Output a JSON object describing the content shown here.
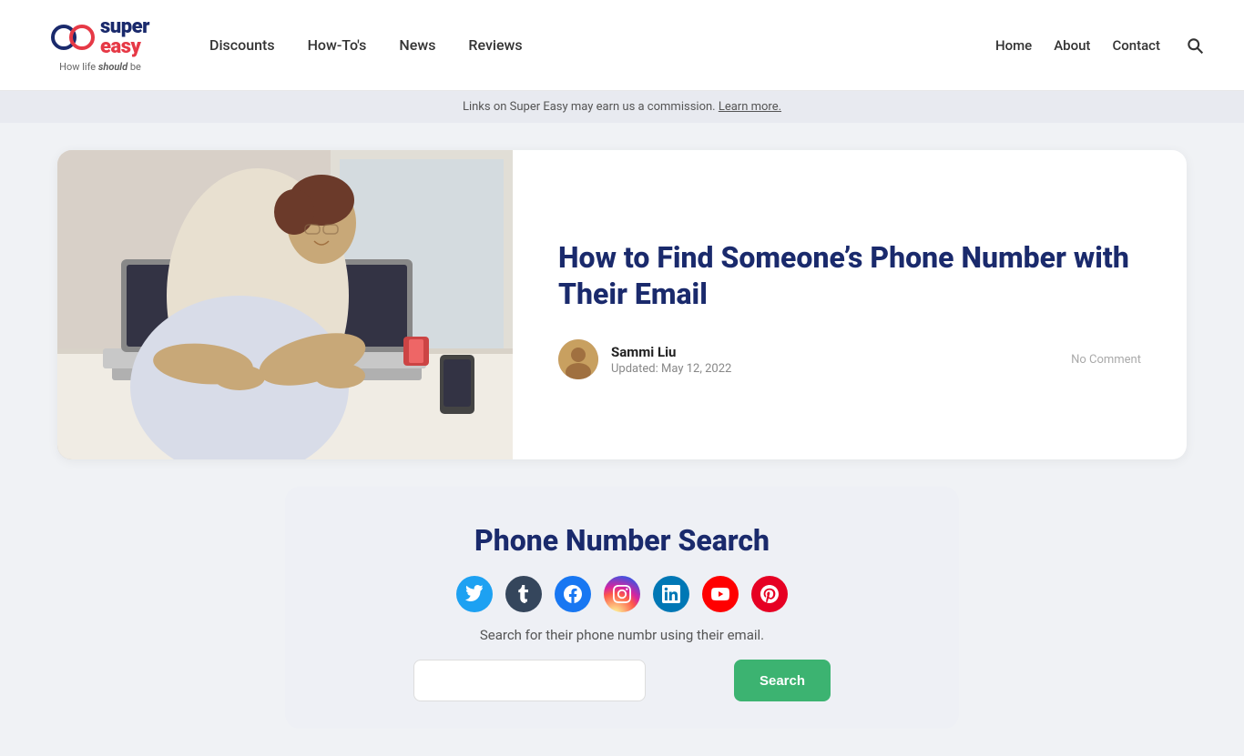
{
  "header": {
    "logo": {
      "brand_super": "super",
      "brand_easy": "easy",
      "tagline": "How life ",
      "tagline_emphasis": "should",
      "tagline_rest": " be"
    },
    "nav": {
      "items": [
        {
          "label": "Discounts",
          "href": "#"
        },
        {
          "label": "How-To's",
          "href": "#"
        },
        {
          "label": "News",
          "href": "#"
        },
        {
          "label": "Reviews",
          "href": "#"
        }
      ]
    },
    "right_nav": {
      "items": [
        {
          "label": "Home",
          "href": "#"
        },
        {
          "label": "About",
          "href": "#"
        },
        {
          "label": "Contact",
          "href": "#"
        }
      ]
    }
  },
  "affiliate_bar": {
    "text": "Links on Super Easy may earn us a commission. ",
    "link_text": "Learn more."
  },
  "article": {
    "title": "How to Find Someone’s Phone Number with Their Email",
    "author_name": "Sammi Liu",
    "updated_label": "Updated:",
    "updated_date": "May 12, 2022",
    "no_comment": "No Comment"
  },
  "widget": {
    "title": "Phone Number Search",
    "description": "Search for their phone numbr using their email.",
    "search_placeholder": "",
    "button_label": "Search"
  },
  "social_icons": [
    {
      "name": "twitter",
      "class": "si-twitter"
    },
    {
      "name": "tumblr",
      "class": "si-tumblr"
    },
    {
      "name": "facebook",
      "class": "si-facebook"
    },
    {
      "name": "instagram",
      "class": "si-instagram"
    },
    {
      "name": "linkedin",
      "class": "si-linkedin"
    },
    {
      "name": "youtube",
      "class": "si-youtube"
    },
    {
      "name": "pinterest",
      "class": "si-pinterest"
    }
  ]
}
